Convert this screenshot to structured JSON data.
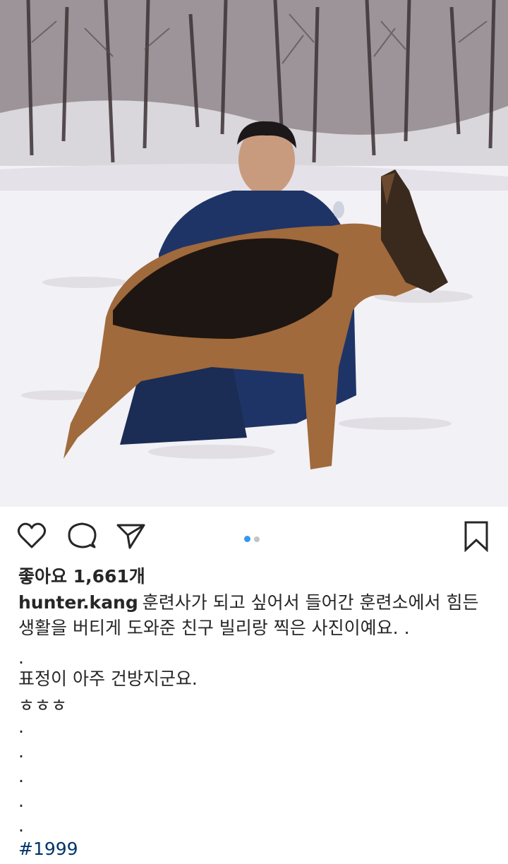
{
  "post": {
    "likes_text": "좋아요 1,661개",
    "username": "hunter.kang",
    "caption_main": "훈련사가 되고 싶어서 들어간 훈련소에서 힘든 생활을 버티게 도와준 친구 빌리랑 찍은 사진이예요. .",
    "caption_lines": [
      ".",
      "표정이 아주 건방지군요.",
      "ㅎㅎㅎ",
      ".",
      ".",
      ".",
      ".",
      "."
    ],
    "hashtag": "#1999"
  },
  "carousel": {
    "count": 2,
    "active_index": 0
  },
  "icons": {
    "like": "heart-icon",
    "comment": "comment-icon",
    "share": "send-icon",
    "save": "bookmark-icon"
  },
  "colors": {
    "text": "#262626",
    "hashtag": "#003569",
    "dot_active": "#3897f0",
    "dot_inactive": "#c4c4c4"
  }
}
